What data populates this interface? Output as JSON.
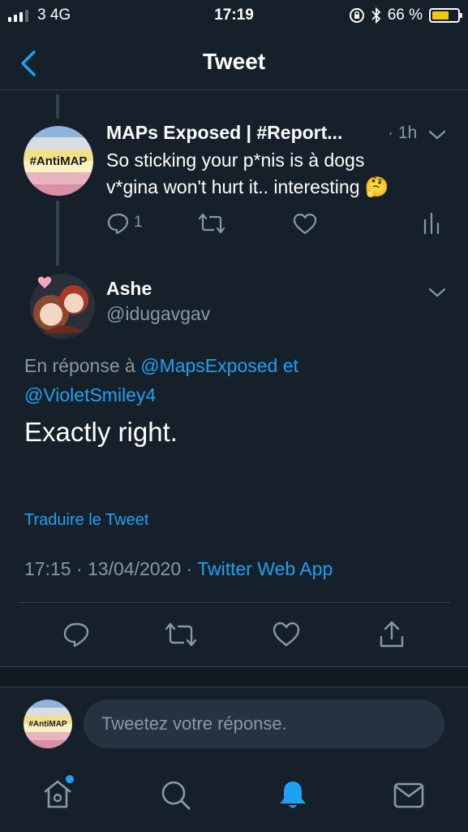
{
  "status_bar": {
    "carrier": "3 4G",
    "time": "17:19",
    "battery_percent": "66 %",
    "battery_level": 0.66,
    "battery_color": "#f7c700"
  },
  "header": {
    "title": "Tweet"
  },
  "parent_tweet": {
    "author": "MAPs Exposed | #Report...",
    "time": "· 1h",
    "text_line1": "So sticking your p*nis is à dogs",
    "text_line2": "v*gina won't  hurt it.. interesting",
    "emoji": "🤔",
    "reply_count": "1",
    "avatar_label": "#AntiMAP"
  },
  "main_tweet": {
    "author_name": "Ashe",
    "handle": "@idugavgav",
    "reply_prefix": "En réponse à",
    "reply_user1": "@MapsExposed",
    "reply_conj": "et",
    "reply_user2": "@VioletSmiley4",
    "text": "Exactly right.",
    "translate": "Traduire le Tweet",
    "time": "17:15",
    "date": "13/04/2020",
    "sep": "·",
    "source": "Twitter Web App"
  },
  "reply_box": {
    "placeholder": "Tweetez votre réponse.",
    "avatar_label": "#AntiMAP"
  },
  "colors": {
    "background": "#15202b",
    "accent": "#1da1f2",
    "muted": "#8899a6",
    "divider": "#38444d"
  },
  "icons": [
    "back-icon",
    "chevron-down-icon",
    "reply-icon",
    "retweet-icon",
    "like-icon",
    "stats-icon",
    "share-icon",
    "home-icon",
    "search-icon",
    "notifications-icon",
    "messages-icon"
  ]
}
